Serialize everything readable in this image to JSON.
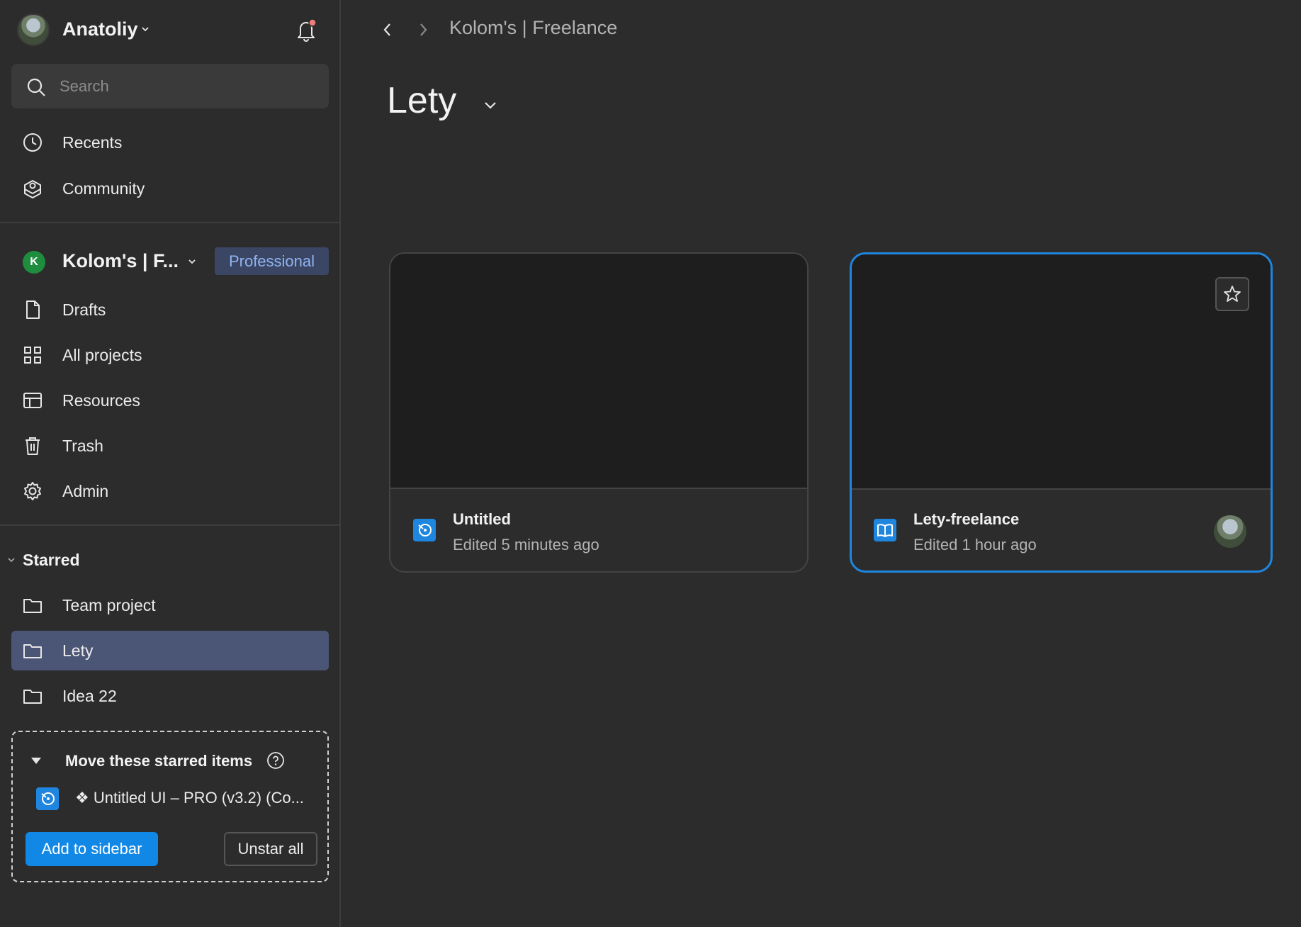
{
  "user": {
    "name": "Anatoliy"
  },
  "search": {
    "placeholder": "Search"
  },
  "nav_top": [
    {
      "label": "Recents",
      "icon": "clock-icon"
    },
    {
      "label": "Community",
      "icon": "community-icon"
    }
  ],
  "team": {
    "initial": "K",
    "name": "Kolom's | F...",
    "plan": "Professional"
  },
  "nav_team": [
    {
      "label": "Drafts",
      "icon": "file-icon"
    },
    {
      "label": "All projects",
      "icon": "grid-icon"
    },
    {
      "label": "Resources",
      "icon": "layout-icon"
    },
    {
      "label": "Trash",
      "icon": "trash-icon"
    },
    {
      "label": "Admin",
      "icon": "gear-icon"
    }
  ],
  "starred": {
    "title": "Starred",
    "items": [
      {
        "label": "Team project",
        "icon": "folder-icon",
        "active": false
      },
      {
        "label": "Lety",
        "icon": "folder-icon",
        "active": true
      },
      {
        "label": "Idea 22",
        "icon": "folder-icon",
        "active": false
      }
    ]
  },
  "move_box": {
    "title": "Move these starred items",
    "file_name": "❖ Untitled UI – PRO (v3.2) (Co...",
    "primary_label": "Add to sidebar",
    "secondary_label": "Unstar all"
  },
  "main": {
    "breadcrumb": "Kolom's | Freelance",
    "title": "Lety",
    "files": [
      {
        "name": "Untitled",
        "meta": "Edited 5 minutes ago",
        "icon": "pen-file-icon",
        "selected": false
      },
      {
        "name": "Lety-freelance",
        "meta": "Edited 1 hour ago",
        "icon": "book-file-icon",
        "selected": true
      }
    ]
  },
  "colors": {
    "background": "#2c2c2c",
    "accent": "#1188e6",
    "active_item": "#4b5576",
    "badge_bg": "#3b4664",
    "badge_text": "#8fb4f0"
  }
}
